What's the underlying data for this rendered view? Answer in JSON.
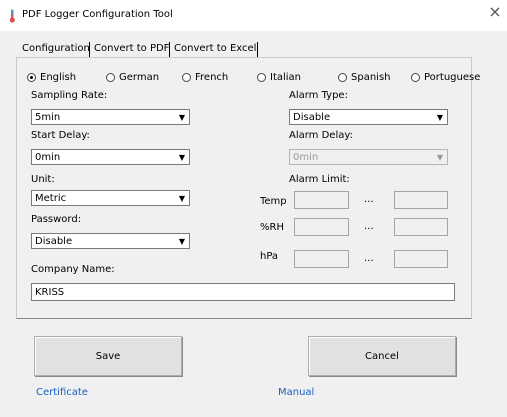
{
  "window": {
    "title": "PDF Logger Configuration Tool"
  },
  "tabs": [
    {
      "label": "Configuration",
      "selected": true
    },
    {
      "label": "Convert to PDF",
      "selected": false
    },
    {
      "label": "Convert to Excel",
      "selected": false
    }
  ],
  "languages": [
    {
      "label": "English",
      "checked": true
    },
    {
      "label": "German",
      "checked": false
    },
    {
      "label": "French",
      "checked": false
    },
    {
      "label": "Italian",
      "checked": false
    },
    {
      "label": "Spanish",
      "checked": false
    },
    {
      "label": "Portuguese",
      "checked": false
    }
  ],
  "sampling_rate": {
    "label": "Sampling Rate:",
    "value": "5min"
  },
  "start_delay": {
    "label": "Start Delay:",
    "value": "0min"
  },
  "unit": {
    "label": "Unit:",
    "value": "Metric"
  },
  "password": {
    "label": "Password:",
    "value": "Disable"
  },
  "company_name": {
    "label": "Company Name:",
    "value": "KRISS"
  },
  "alarm_type": {
    "label": "Alarm Type:",
    "value": "Disable"
  },
  "alarm_delay": {
    "label": "Alarm Delay:",
    "value": "0min",
    "disabled": true
  },
  "alarm_limit": {
    "label": "Alarm Limit:",
    "separator": "...",
    "rows": [
      {
        "label": "Temp",
        "low": "",
        "high": ""
      },
      {
        "label": "%RH",
        "low": "",
        "high": ""
      },
      {
        "label": "hPa",
        "low": "",
        "high": ""
      }
    ]
  },
  "buttons": {
    "save": "Save",
    "cancel": "Cancel"
  },
  "links": {
    "certificate": "Certificate",
    "manual": "Manual"
  },
  "icons": {
    "app": "thermometer-icon",
    "close": "close-icon",
    "dropdown": "chevron-down-icon"
  },
  "colors": {
    "link": "#1c5fbf",
    "titlebar": "#ffffff",
    "window": "#f0f0f0"
  }
}
